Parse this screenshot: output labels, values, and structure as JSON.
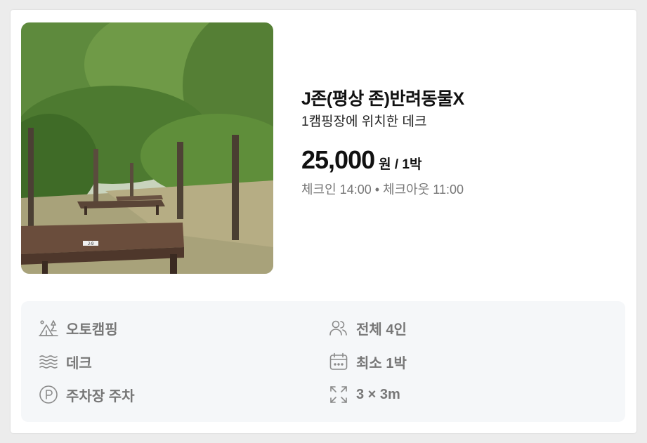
{
  "site": {
    "title": "J존(평상 존)반려동물X",
    "subtitle": "1캠핑장에 위치한 데크",
    "price": "25,000",
    "price_unit": "원 / 1박",
    "checkinout": "체크인 14:00 • 체크아웃 11:00",
    "photo_label": "J-9"
  },
  "features": {
    "left": [
      {
        "icon": "tent-trees-icon",
        "label": "오토캠핑"
      },
      {
        "icon": "waves-icon",
        "label": "데크"
      },
      {
        "icon": "parking-icon",
        "label": "주차장 주차"
      }
    ],
    "right": [
      {
        "icon": "users-icon",
        "label": "전체 4인"
      },
      {
        "icon": "calendar-icon",
        "label": "최소 1박"
      },
      {
        "icon": "expand-icon",
        "label": "3 × 3m"
      }
    ]
  },
  "colors": {
    "feature_bg": "#f5f7f9",
    "muted_text": "#777777",
    "icon": "#8a8a8a"
  }
}
